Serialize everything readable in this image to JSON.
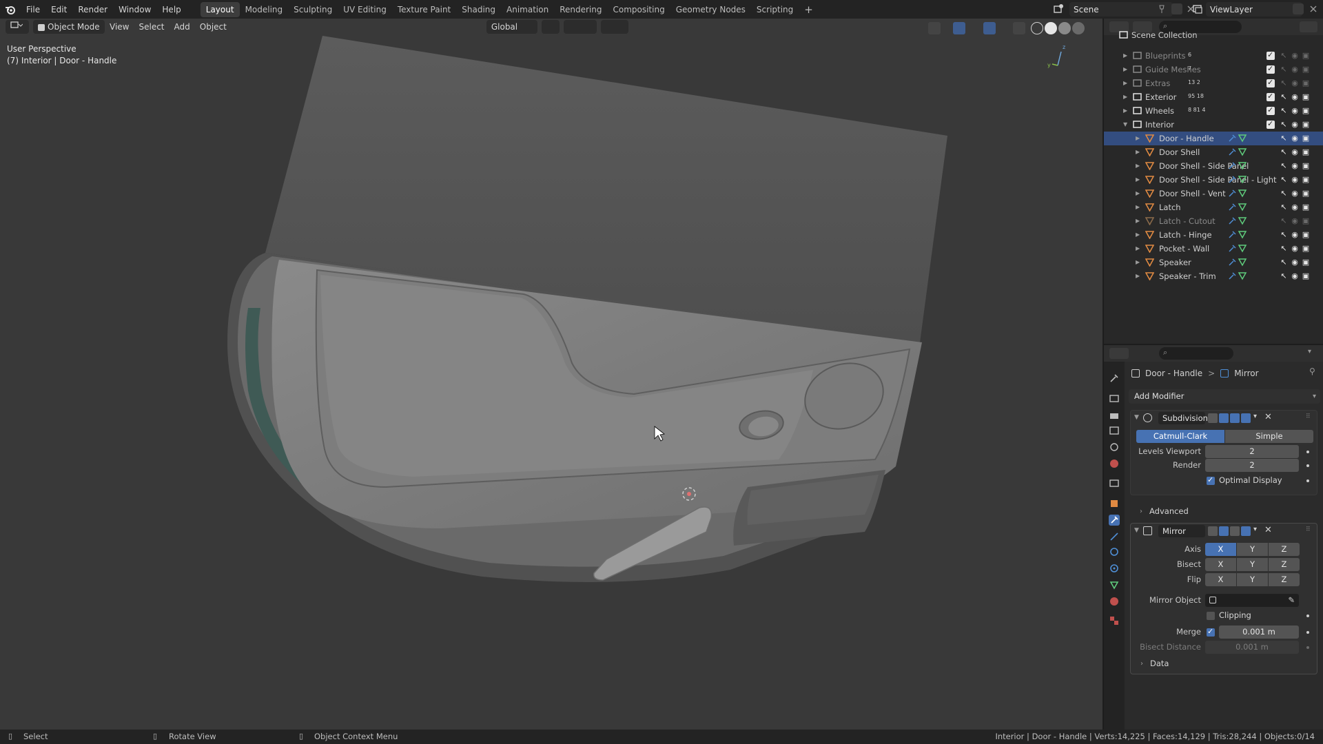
{
  "menu": [
    "File",
    "Edit",
    "Render",
    "Window",
    "Help"
  ],
  "workspaces": [
    {
      "label": "Layout",
      "active": true
    },
    {
      "label": "Modeling"
    },
    {
      "label": "Sculpting"
    },
    {
      "label": "UV Editing"
    },
    {
      "label": "Texture Paint"
    },
    {
      "label": "Shading"
    },
    {
      "label": "Animation"
    },
    {
      "label": "Rendering"
    },
    {
      "label": "Compositing"
    },
    {
      "label": "Geometry Nodes"
    },
    {
      "label": "Scripting"
    }
  ],
  "add_workspace": "+",
  "scene_name": "Scene",
  "view_layer": "ViewLayer",
  "viewport": {
    "mode": "Object Mode",
    "menus": [
      "View",
      "Select",
      "Add",
      "Object"
    ],
    "transform_orientation": "Global",
    "perspective_label": "User Perspective",
    "active_label": "(7) Interior | Door - Handle"
  },
  "outliner": {
    "root": "Scene Collection",
    "collections": [
      {
        "name": "Blueprints",
        "badge": "6",
        "dim": true
      },
      {
        "name": "Guide Meshes",
        "badge": "7",
        "dim": true
      },
      {
        "name": "Extras",
        "badge": "13 2",
        "dim": true
      },
      {
        "name": "Exterior",
        "badge": "95 18",
        "dim": false
      },
      {
        "name": "Wheels",
        "badge": "8 81 4",
        "dim": false
      },
      {
        "name": "Interior",
        "badge": "",
        "dim": false,
        "expanded": true
      }
    ],
    "objects": [
      {
        "name": "Door - Handle",
        "dim": false
      },
      {
        "name": "Door Shell",
        "dim": false
      },
      {
        "name": "Door Shell - Side Panel",
        "dim": false
      },
      {
        "name": "Door Shell - Side Panel - Light",
        "dim": false
      },
      {
        "name": "Door Shell - Vent",
        "dim": false
      },
      {
        "name": "Latch",
        "dim": false
      },
      {
        "name": "Latch - Cutout",
        "dim": true
      },
      {
        "name": "Latch - Hinge",
        "dim": false
      },
      {
        "name": "Pocket - Wall",
        "dim": false
      },
      {
        "name": "Speaker",
        "dim": false
      },
      {
        "name": "Speaker - Trim",
        "dim": false
      }
    ]
  },
  "properties": {
    "breadcrumb_object": "Door - Handle",
    "breadcrumb_sep": ">",
    "breadcrumb_modifier": "Mirror",
    "add_modifier": "Add Modifier",
    "subdivision": {
      "name": "Subdivision",
      "type_catmull": "Catmull-Clark",
      "type_simple": "Simple",
      "levels_viewport_label": "Levels Viewport",
      "levels_viewport": "2",
      "render_label": "Render",
      "render": "2",
      "optimal_display": "Optimal Display",
      "advanced": "Advanced"
    },
    "mirror": {
      "name": "Mirror",
      "axis_label": "Axis",
      "bisect_label": "Bisect",
      "flip_label": "Flip",
      "x": "X",
      "y": "Y",
      "z": "Z",
      "mirror_object_label": "Mirror Object",
      "clipping": "Clipping",
      "merge_label": "Merge",
      "merge_value": "0.001 m",
      "bisect_distance_label": "Bisect Distance",
      "bisect_distance_value": "0.001 m",
      "data": "Data"
    }
  },
  "statusbar": {
    "select": "Select",
    "rotate": "Rotate View",
    "context": "Object Context Menu",
    "stats": "Interior | Door - Handle | Verts:14,225 | Faces:14,129 | Tris:28,244 | Objects:0/14"
  },
  "colors": {
    "accent": "#4772b3",
    "mesh_icon": "#e08a42",
    "data_icon": "#5fcc7c"
  }
}
